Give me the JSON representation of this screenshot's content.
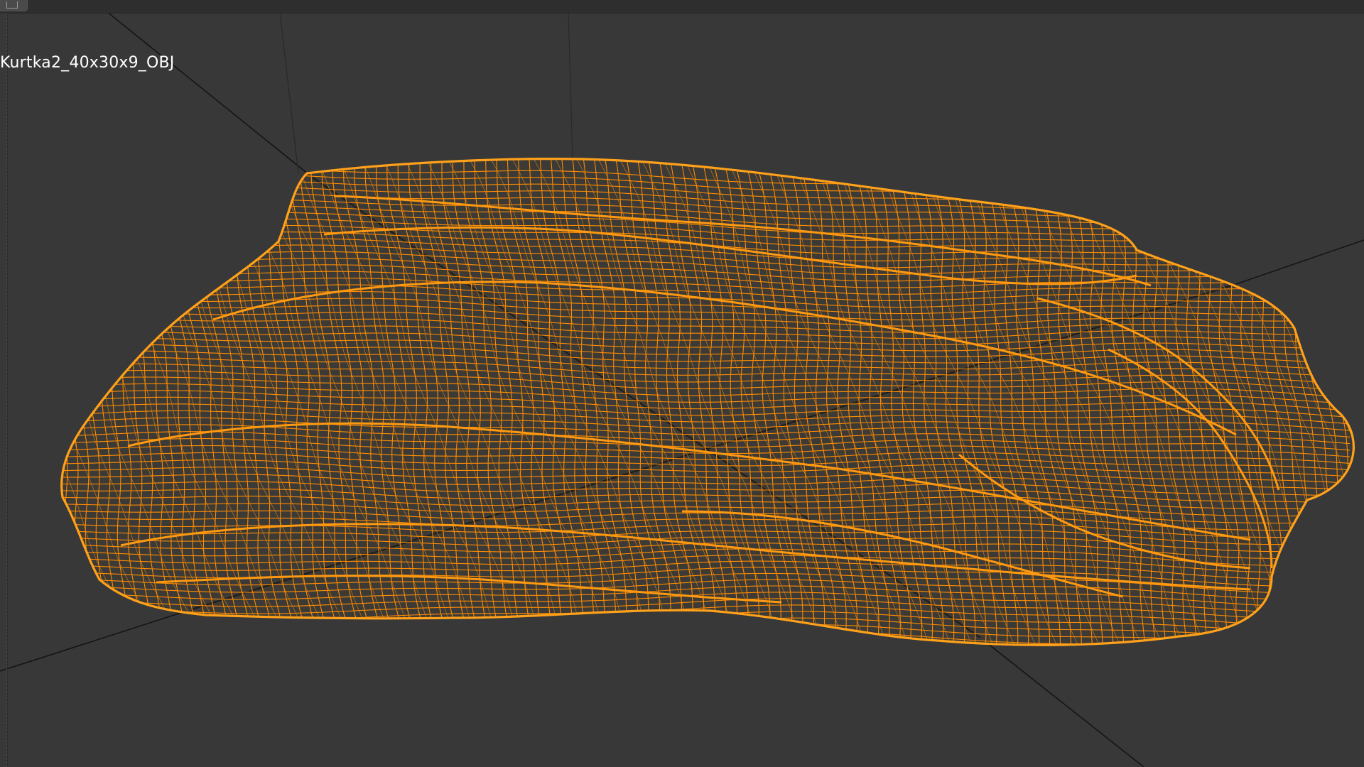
{
  "viewport": {
    "object_name": "Kurtka2_40x30x9_OBJ",
    "colors": {
      "background": "#383838",
      "wireframe": "#ff8c00",
      "wireframe_bright": "#ffa11a",
      "grid_line": "#111111"
    },
    "shading_mode_icon": "viewport-editor-type-icon"
  }
}
